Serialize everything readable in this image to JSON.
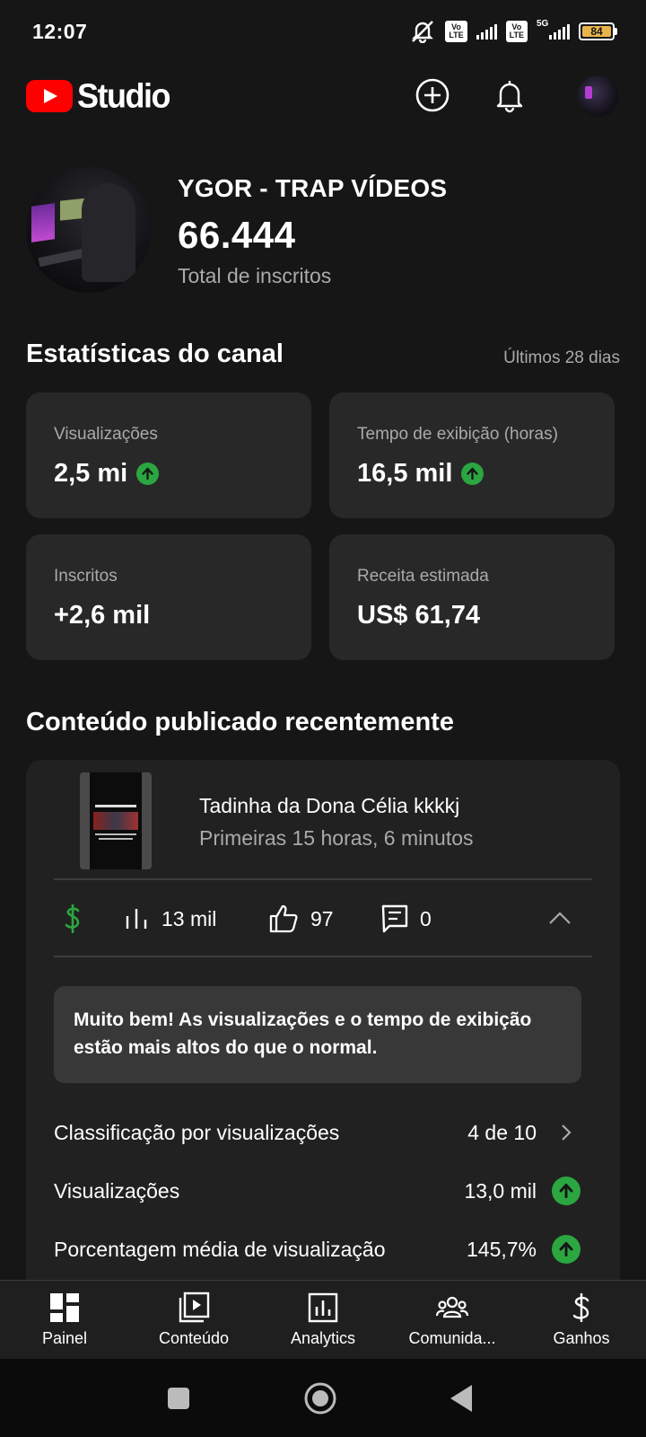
{
  "status_bar": {
    "time": "12:07",
    "volte_1": "Vo LTE",
    "volte_2": "Vo LTE",
    "network": "5G",
    "battery": "84",
    "icons": [
      "mute-alarm-icon",
      "signal-icon",
      "battery-icon"
    ]
  },
  "header": {
    "logo_text": "Studio",
    "actions": [
      "create-icon",
      "notifications-icon",
      "account-avatar"
    ]
  },
  "channel": {
    "name": "YGOR - TRAP VÍDEOS",
    "subscribers": "66.444",
    "subscribers_label": "Total de inscritos"
  },
  "stats": {
    "title": "Estatísticas do canal",
    "period": "Últimos 28 dias",
    "cards": [
      {
        "label": "Visualizações",
        "value": "2,5 mi",
        "trend": "up"
      },
      {
        "label": "Tempo de exibição (horas)",
        "value": "16,5 mil",
        "trend": "up"
      },
      {
        "label": "Inscritos",
        "value": "+2,6 mil",
        "trend": ""
      },
      {
        "label": "Receita estimada",
        "value": "US$ 61,74",
        "trend": ""
      }
    ]
  },
  "recent": {
    "title": "Conteúdo publicado recentemente",
    "video": {
      "title": "Tadinha da Dona Célia kkkkj",
      "subtitle": "Primeiras 15 horas, 6 minutos",
      "views": "13 mil",
      "likes": "97",
      "comments": "0"
    },
    "insight": "Muito bem! As visualizações e o tempo de exibição estão mais altos do que o normal.",
    "rows": [
      {
        "label": "Classificação por visualizações",
        "value": "4 de 10"
      },
      {
        "label": "Visualizações",
        "value": "13,0 mil"
      },
      {
        "label": "Porcentagem média de visualização",
        "value": "145,7%"
      }
    ]
  },
  "bottom_nav": [
    {
      "label": "Painel",
      "icon": "dashboard-icon"
    },
    {
      "label": "Conteúdo",
      "icon": "content-icon"
    },
    {
      "label": "Analytics",
      "icon": "analytics-icon"
    },
    {
      "label": "Comunida...",
      "icon": "community-icon"
    },
    {
      "label": "Ganhos",
      "icon": "earn-icon"
    }
  ],
  "colors": {
    "background": "#161616",
    "card": "#282828",
    "accent_red": "#ff0000",
    "trend_green": "#2ba640",
    "monetization_green": "#2ba640"
  }
}
